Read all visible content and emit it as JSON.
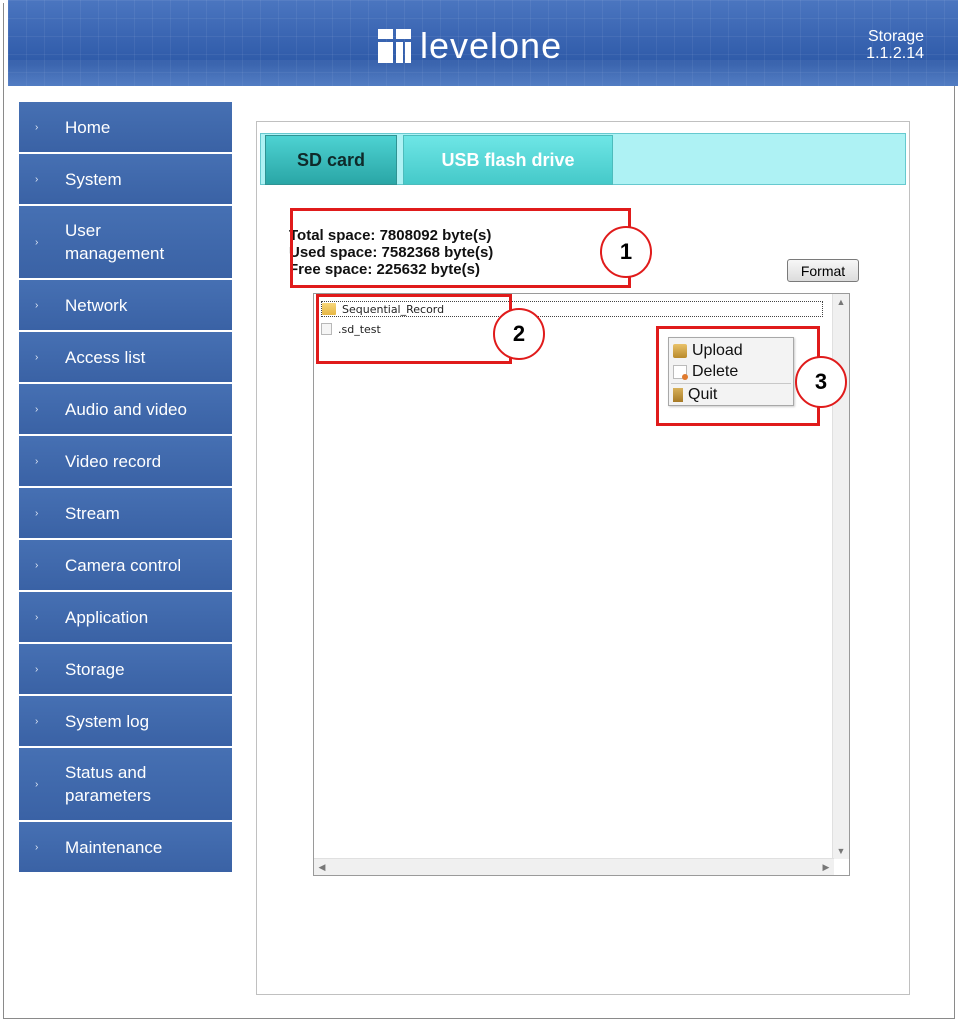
{
  "header": {
    "brand": "levelone",
    "section": "Storage",
    "version": "1.1.2.14"
  },
  "sidebar": {
    "items": [
      {
        "label": "Home"
      },
      {
        "label": "System"
      },
      {
        "label": "User\nmanagement"
      },
      {
        "label": "Network"
      },
      {
        "label": "Access list"
      },
      {
        "label": "Audio and video"
      },
      {
        "label": "Video record"
      },
      {
        "label": "Stream"
      },
      {
        "label": "Camera control"
      },
      {
        "label": "Application"
      },
      {
        "label": "Storage"
      },
      {
        "label": "System log"
      },
      {
        "label": "Status and\nparameters"
      },
      {
        "label": "Maintenance"
      }
    ]
  },
  "tabs": {
    "sd": "SD card",
    "usb": "USB flash drive"
  },
  "space": {
    "total": "Total space: 7808092 byte(s)",
    "used": "Used space: 7582368 byte(s)",
    "free": "Free space: 225632 byte(s)"
  },
  "format_label": "Format",
  "files": [
    {
      "name": "Sequential_Record",
      "type": "folder"
    },
    {
      "name": ".sd_test",
      "type": "file"
    }
  ],
  "context_menu": {
    "upload": "Upload",
    "delete": "Delete",
    "quit": "Quit"
  },
  "annotations": [
    "1",
    "2",
    "3"
  ],
  "colors": {
    "nav_bg": "#3d65a8",
    "tab_bar": "#aef2f4",
    "annotation_red": "#e01b1b"
  }
}
